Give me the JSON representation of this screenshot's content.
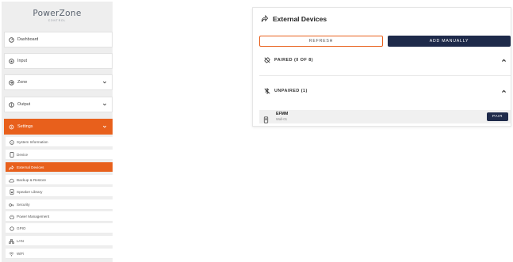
{
  "logo": {
    "main": "PowerZone",
    "sub": "CONTROL"
  },
  "nav": {
    "dashboard": "Dashboard",
    "input": "Input",
    "zone": "Zone",
    "output": "Output",
    "settings": "Settings"
  },
  "settings_items": [
    {
      "label": "System Information",
      "icon": "info-icon"
    },
    {
      "label": "Device",
      "icon": "device-icon"
    },
    {
      "label": "External Devices",
      "icon": "share-arrow-icon"
    },
    {
      "label": "Backup & Restore",
      "icon": "cloud-icon"
    },
    {
      "label": "Speaker Library",
      "icon": "speaker-icon"
    },
    {
      "label": "Security",
      "icon": "key-icon"
    },
    {
      "label": "Power Management",
      "icon": "power-icon"
    },
    {
      "label": "GPIO",
      "icon": "circle-icon"
    },
    {
      "label": "LAN",
      "icon": "network-icon"
    },
    {
      "label": "WiFi",
      "icon": "wifi-icon"
    }
  ],
  "panel": {
    "title": "External Devices",
    "refresh_label": "REFRESH",
    "add_label": "ADD MANUALLY",
    "paired_label": "PAIRED (0 OF 8)",
    "unpaired_label": "UNPAIRED (1)",
    "device": {
      "name": "EFMM",
      "location": "Wall-01",
      "pair_label": "PAIR"
    }
  },
  "colors": {
    "accent": "#e8601c",
    "navy": "#1e2a4a"
  }
}
